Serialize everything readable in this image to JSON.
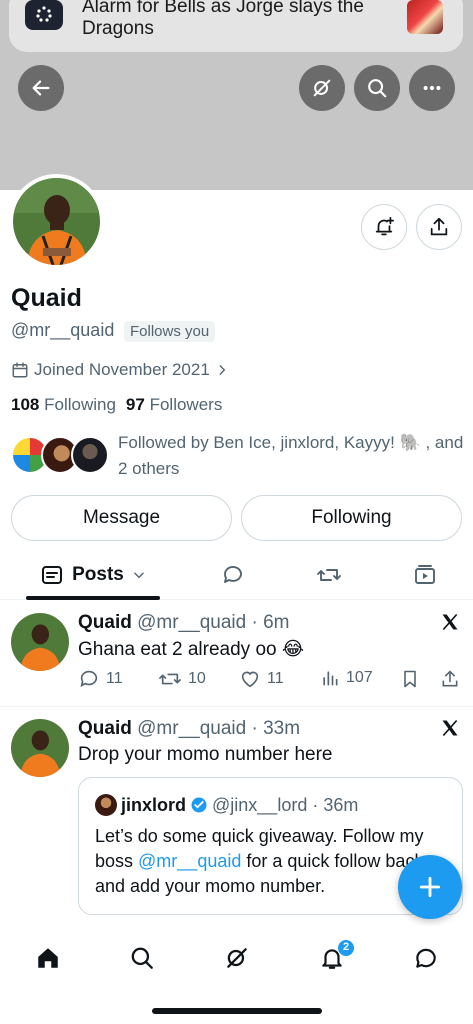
{
  "notification": {
    "text": "Alarm for Bells as Jorge slays the Dragons"
  },
  "header": {
    "back_icon": "arrow-left-icon",
    "grok_icon": "grok-icon",
    "search_icon": "search-icon",
    "more_icon": "more-icon"
  },
  "profile": {
    "name": "Quaid",
    "handle": "@mr__quaid",
    "follows_you": "Follows you",
    "joined": "Joined November 2021",
    "following_count": "108",
    "following_label": "Following",
    "followers_count": "97",
    "followers_label": "Followers",
    "followed_by": "Followed by Ben Ice, jinxlord, Kayyy! 🐘 , and 2 others"
  },
  "buttons": {
    "message": "Message",
    "following": "Following"
  },
  "tabs": {
    "posts": "Posts"
  },
  "posts": [
    {
      "name": "Quaid",
      "meta": "@mr__quaid · 6m",
      "text": "Ghana eat 2 already oo 😂",
      "replies": "11",
      "reposts": "10",
      "likes": "11",
      "views": "107"
    },
    {
      "name": "Quaid",
      "meta": "@mr__quaid · 33m",
      "text": "Drop your momo number here",
      "quote": {
        "name": "jinxlord",
        "meta": "@jinx__lord · 36m",
        "text_before": "Let’s do some quick giveaway. Follow my boss ",
        "mention": "@mr__quaid",
        "text_after": " for a quick follow back and add your momo number."
      }
    }
  ],
  "nav": {
    "notifications_badge": "2"
  },
  "colors": {
    "accent": "#1d9bf0",
    "text": "#0f1419",
    "muted": "#536471"
  }
}
